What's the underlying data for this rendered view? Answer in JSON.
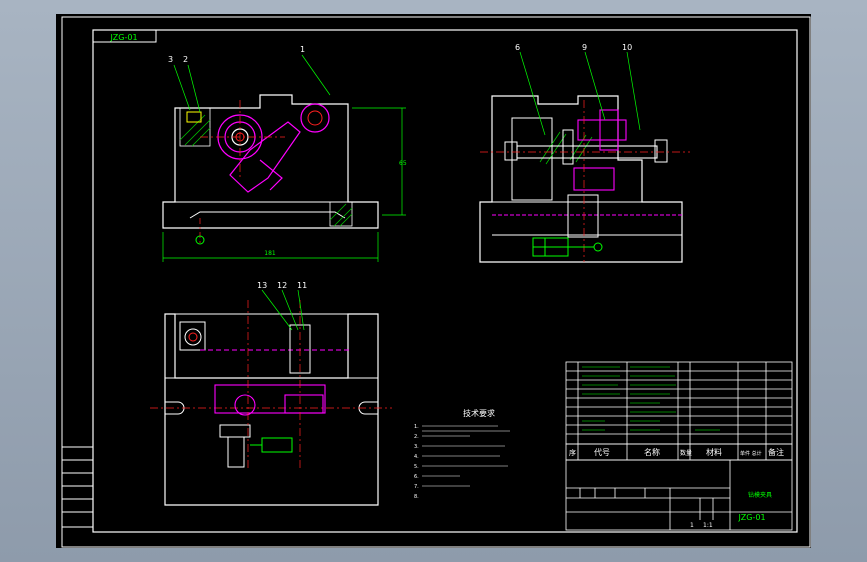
{
  "drawing_code": "JZG-01",
  "balloons": [
    "1",
    "2",
    "3",
    "6",
    "9",
    "10",
    "11",
    "12",
    "13"
  ],
  "dims": {
    "front_width": "181",
    "front_height": "65"
  },
  "tech_req": {
    "title": "技术要求",
    "items": [
      "1.",
      "2.",
      "3.",
      "4.",
      "5.",
      "6.",
      "7.",
      "8."
    ]
  },
  "bom_header": {
    "seq": "序",
    "code": "代号",
    "name": "名称",
    "qty": "数量",
    "material": "材料",
    "weight": "单件 总计",
    "note": "备注"
  },
  "title_block": {
    "drawing_name": "钻模夹具",
    "code": "JZG-01",
    "scale": "1:1",
    "sheet": "1"
  },
  "colors": {
    "outline": "#ffffff",
    "magenta": "#ff00ff",
    "green": "#00ff00",
    "cyan": "#00ffff",
    "yellow": "#ffff00",
    "red": "#ff2020",
    "hatch": "#00c000",
    "frame": "#ffffff"
  }
}
